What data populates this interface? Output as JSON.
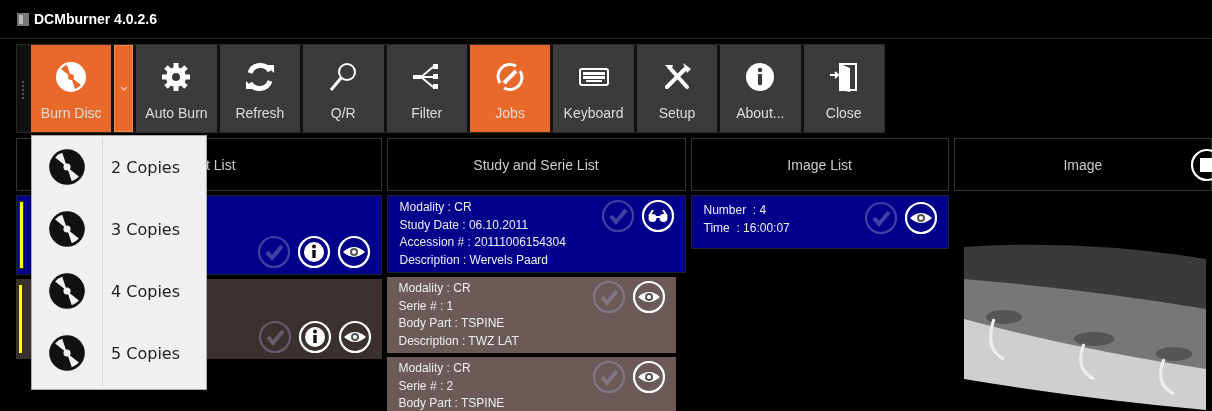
{
  "window": {
    "title": "DCMburner 4.0.2.6"
  },
  "toolbar": [
    {
      "label": "Burn Disc",
      "highlighted": true,
      "dropdown": true
    },
    {
      "label": "Auto Burn",
      "highlighted": false
    },
    {
      "label": "Refresh",
      "highlighted": false
    },
    {
      "label": "Q/R",
      "highlighted": false
    },
    {
      "label": "Filter",
      "highlighted": false
    },
    {
      "label": "Jobs",
      "highlighted": true
    },
    {
      "label": "Keyboard",
      "highlighted": false
    },
    {
      "label": "Setup",
      "highlighted": false
    },
    {
      "label": "About...",
      "highlighted": false
    },
    {
      "label": "Close",
      "highlighted": false
    }
  ],
  "burn_menu": [
    {
      "label": "2 Copies"
    },
    {
      "label": "3 Copies"
    },
    {
      "label": "4 Copies"
    },
    {
      "label": "5 Copies"
    }
  ],
  "panels": [
    {
      "kind": "patient",
      "header": "t List",
      "rows": [
        {
          "kind": "patient",
          "selected": true,
          "lines": []
        },
        {
          "kind": "patient",
          "selected": false,
          "lines": []
        }
      ]
    },
    {
      "kind": "study",
      "header": "Study and Serie List",
      "rows": [
        {
          "kind": "study",
          "selected": true,
          "lines": [
            "Modality : CR",
            "Study Date : 06.10.2011",
            "Accession # : 20111006154304",
            "Description : Wervels Paard"
          ]
        },
        {
          "kind": "serie",
          "selected": false,
          "lines": [
            "Modality : CR",
            "Serie # : 1",
            "Body Part : TSPINE",
            "Description : TWZ LAT"
          ]
        },
        {
          "kind": "serie",
          "selected": false,
          "lines": [
            "Modality : CR",
            "Serie # : 2",
            "Body Part : TSPINE"
          ]
        }
      ]
    },
    {
      "kind": "image_list",
      "header": "Image List",
      "rows": [
        {
          "selected": true,
          "lines": [
            "Number  : 4",
            "Time  : 16:00:07"
          ]
        }
      ]
    },
    {
      "header": "Image"
    }
  ]
}
